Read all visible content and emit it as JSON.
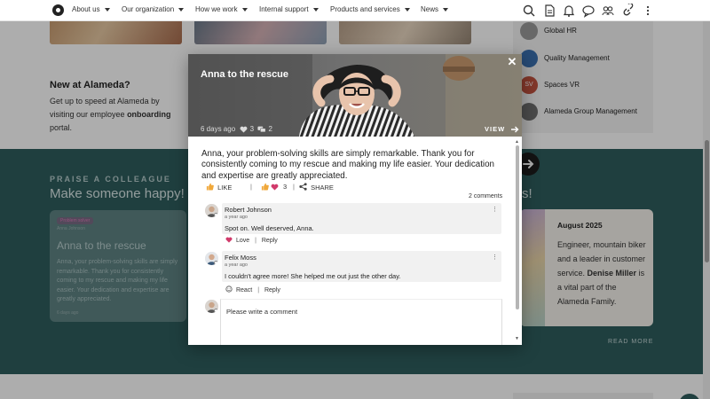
{
  "nav": {
    "items": [
      {
        "label": "About us"
      },
      {
        "label": "Our organization"
      },
      {
        "label": "How we work"
      },
      {
        "label": "Internal support"
      },
      {
        "label": "Products and services"
      },
      {
        "label": "News"
      }
    ],
    "icons": [
      "search-icon",
      "document-icon",
      "bell-icon",
      "chat-icon",
      "people-icon",
      "groups-icon",
      "link-icon",
      "more-vertical-icon"
    ]
  },
  "background": {
    "new_title": "New at Alameda?",
    "new_text_1": "Get up to speed at Alameda by visiting our employee",
    "new_text_bold": "onboarding",
    "new_text_2": "portal.",
    "right_panel": [
      {
        "label": "Global HR",
        "avatar": ""
      },
      {
        "label": "Quality Management",
        "avatar": ""
      },
      {
        "label": "Spaces VR",
        "avatar": "SV"
      },
      {
        "label": "Alameda Group Management",
        "avatar": ""
      }
    ],
    "praise_kicker": "PRAISE A COLLEAGUE",
    "praise_title": "Make someone happy!",
    "praise_card": {
      "badge": "Problem solver",
      "name": "Anna Johnson",
      "title": "Anna to the rescue",
      "text": "Anna, your problem-solving skills are simply remarkable. Thank you for consistently coming to my rescue and making my life easier. Your dedication and expertise are greatly appreciated.",
      "time": "6 days ago"
    },
    "teal_fragment": "s!",
    "birthday": {
      "date": "August 2025",
      "text_1": "Engineer, mountain biker and a leader in customer service.",
      "name": "Denise Miller",
      "text_2": "is a vital part of the Alameda Family."
    },
    "read_more": "READ MORE"
  },
  "modal": {
    "title": "Anna to the rescue",
    "close": "✕",
    "meta_time": "6 days ago",
    "meta_likes": "3",
    "meta_comments": "2",
    "view_label": "VIEW",
    "body": "Anna, your problem-solving skills are simply remarkable. Thank you for consistently coming to my rescue and making my life easier. Your dedication and expertise are greatly appreciated.",
    "like_label": "LIKE",
    "reaction_count": "3",
    "share_label": "SHARE",
    "comment_count_label": "2 comments",
    "comments": [
      {
        "name": "Robert Johnson",
        "time": "a year ago",
        "text": "Spot on. Well deserved, Anna.",
        "reaction_label": "Love",
        "reply_label": "Reply"
      },
      {
        "name": "Felix Moss",
        "time": "a year ago",
        "text": "I couldn't agree more! She helped me out just the other day.",
        "reaction_label": "React",
        "reply_label": "Reply"
      }
    ],
    "write_placeholder": "Please write a comment"
  },
  "colors": {
    "teal": "#2f5e5e",
    "love": "#d13a6b"
  }
}
